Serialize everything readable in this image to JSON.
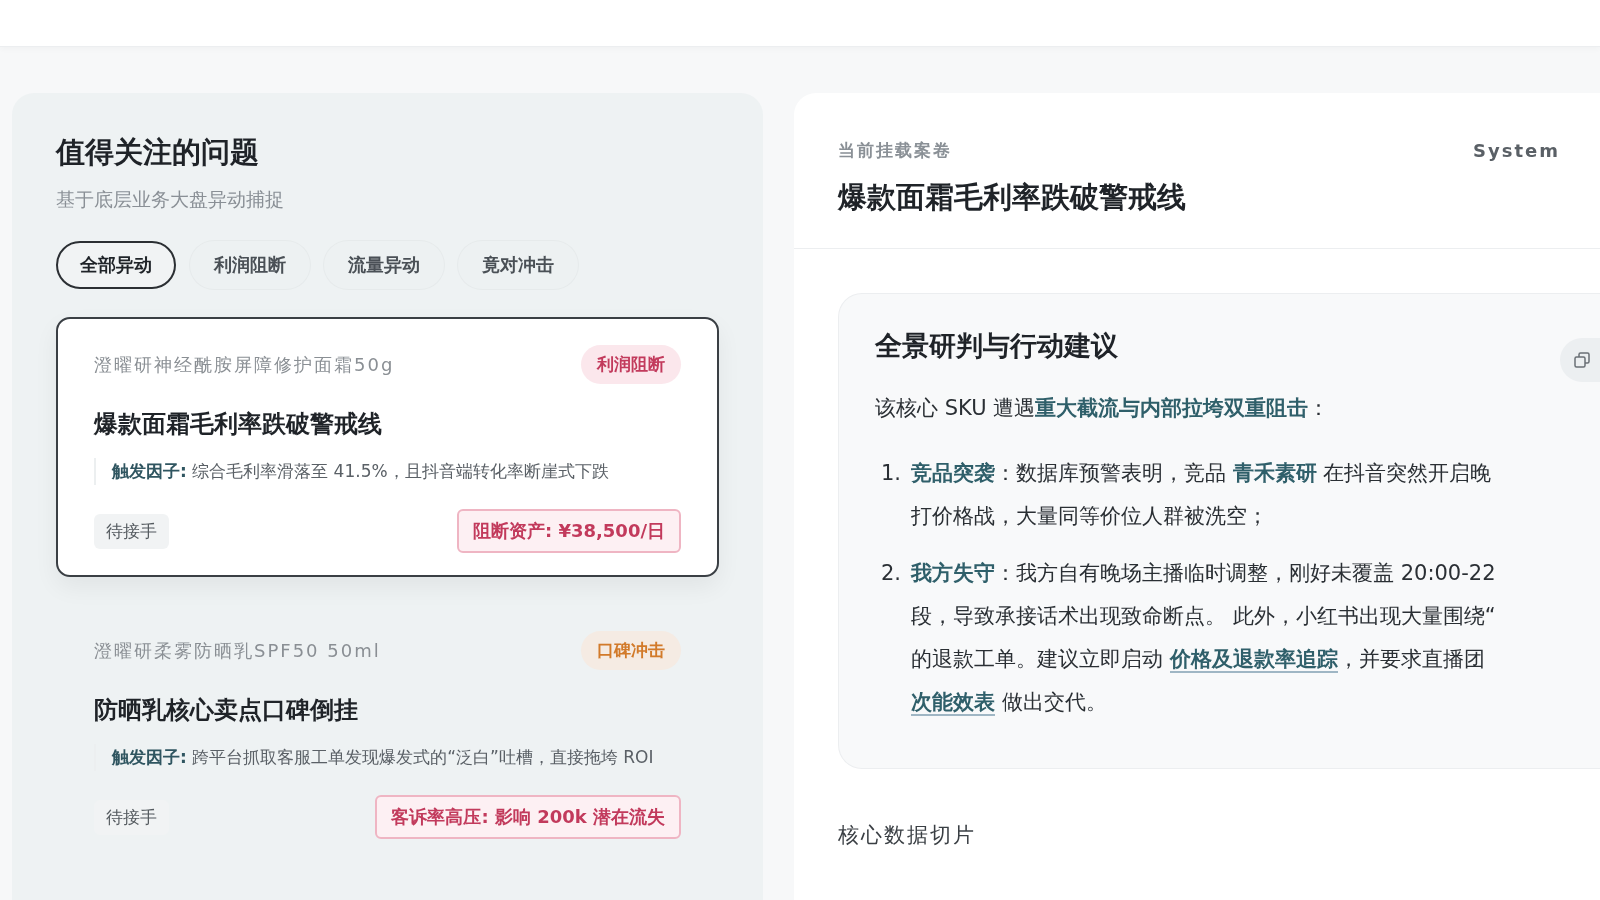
{
  "issues_panel": {
    "title": "值得关注的问题",
    "subtitle": "基于底层业务大盘异动捕捉",
    "filters": [
      {
        "label": "全部异动",
        "selected": true
      },
      {
        "label": "利润阻断",
        "selected": false
      },
      {
        "label": "流量异动",
        "selected": false
      },
      {
        "label": "竟对冲击",
        "selected": false
      }
    ],
    "issues": [
      {
        "product": "澄曜研神经酰胺屏障修护面霜50g",
        "tag": {
          "label": "利润阻断",
          "kind": "profit"
        },
        "title": "爆款面霜毛利率跌破警戒线",
        "trigger_label": "触发因子:",
        "trigger": "综合毛利率滑落至 41.5%，且抖音端转化率断崖式下跌",
        "status": "待接手",
        "impact": "阻断资产: ¥38,500/日",
        "selected": true
      },
      {
        "product": "澄曜研柔雾防晒乳SPF50 50ml",
        "tag": {
          "label": "口碑冲击",
          "kind": "reputation"
        },
        "title": "防晒乳核心卖点口碑倒挂",
        "trigger_label": "触发因子:",
        "trigger": "跨平台抓取客服工单发现爆发式的“泛白”吐槽，直接拖垮 ROI",
        "status": "待接手",
        "impact": "客诉率高压: 影响 200k 潜在流失",
        "selected": false
      }
    ]
  },
  "case_panel": {
    "eyebrow": "当前挂载案卷",
    "title": "爆款面霜毛利率跌破警戒线",
    "badge": "System",
    "analysis": {
      "title": "全景研判与行动建议",
      "intro": [
        {
          "kind": "plain",
          "text": "该核心 SKU 遭遇"
        },
        {
          "kind": "em",
          "text": "重大截流与内部拉垮双重阻击"
        },
        {
          "kind": "plain",
          "text": "："
        }
      ],
      "items": [
        {
          "number": "1.",
          "lines": [
            [
              {
                "kind": "em",
                "text": "竞品突袭"
              },
              {
                "kind": "plain",
                "text": "：数据库预警表明，竞品 "
              },
              {
                "kind": "em",
                "text": "青禾素研"
              },
              {
                "kind": "plain",
                "text": " 在抖音突然开启晚"
              }
            ],
            [
              {
                "kind": "plain",
                "text": "打价格战，大量同等价位人群被洗空；"
              }
            ]
          ]
        },
        {
          "number": "2.",
          "lines": [
            [
              {
                "kind": "em",
                "text": "我方失守"
              },
              {
                "kind": "plain",
                "text": "：我方自有晚场主播临时调整，刚好未覆盖 20:00-22"
              }
            ],
            [
              {
                "kind": "plain",
                "text": "段，导致承接话术出现致命断点。 此外，小红书出现大量围绕“"
              }
            ],
            [
              {
                "kind": "plain",
                "text": "的退款工单。建议立即启动 "
              },
              {
                "kind": "link",
                "text": "价格及退款率追踪"
              },
              {
                "kind": "plain",
                "text": "，并要求直播团"
              }
            ],
            [
              {
                "kind": "link",
                "text": "次能效表"
              },
              {
                "kind": "plain",
                "text": " 做出交代。"
              }
            ]
          ]
        }
      ]
    },
    "section_title": "核心数据切片"
  }
}
